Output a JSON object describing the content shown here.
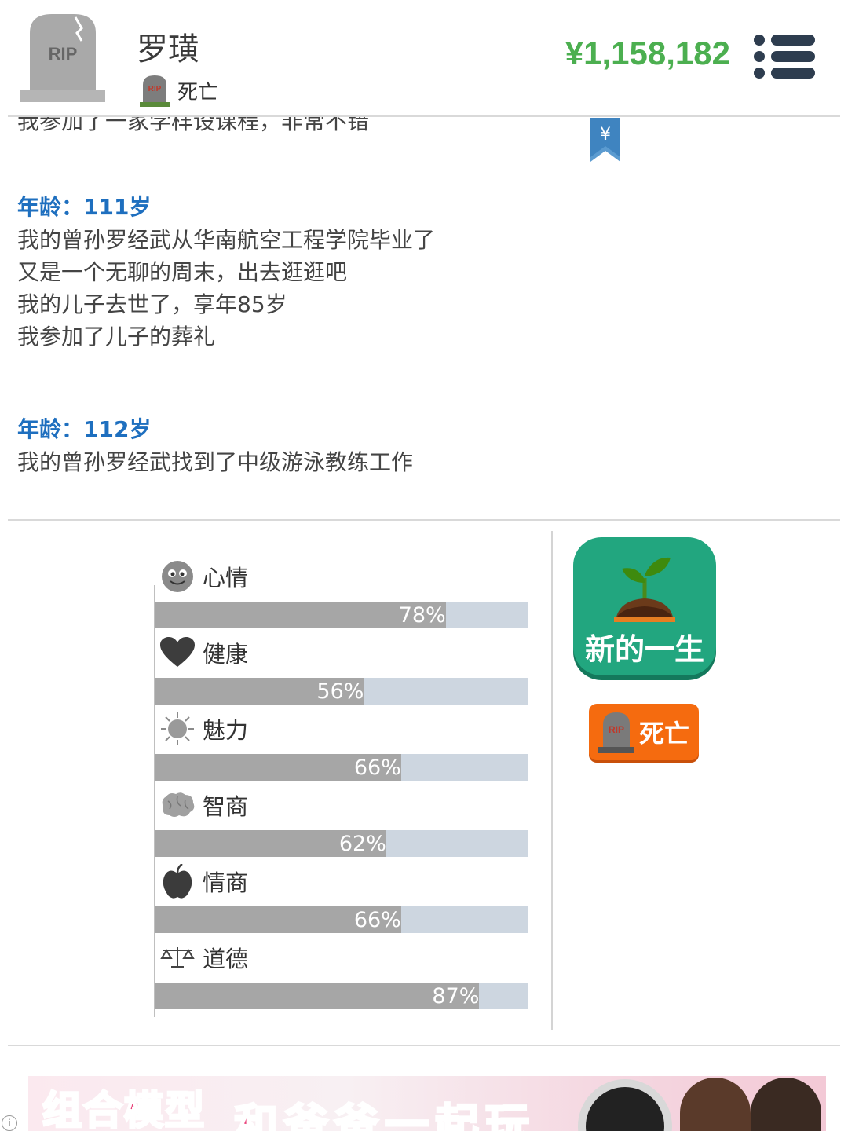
{
  "header": {
    "avatar_text": "RIP",
    "name": "罗璜",
    "status": "死亡",
    "money": "¥1,158,182"
  },
  "log": {
    "clipped_line": "我参加了一家学样设课程，非常不错",
    "bookmark_symbol": "¥",
    "entries": [
      {
        "age": "年龄：111岁",
        "lines": [
          "我的曾孙罗经武从华南航空工程学院毕业了",
          "又是一个无聊的周末，出去逛逛吧",
          "我的儿子去世了，享年85岁",
          "我参加了儿子的葬礼"
        ]
      },
      {
        "age": "年龄：112岁",
        "lines": [
          "我的曾孙罗经武找到了中级游泳教练工作"
        ]
      }
    ]
  },
  "stats": [
    {
      "label": "心情",
      "value": 78,
      "pct": "78%",
      "icon": "smiley-face-icon"
    },
    {
      "label": "健康",
      "value": 56,
      "pct": "56%",
      "icon": "heart-icon"
    },
    {
      "label": "魅力",
      "value": 66,
      "pct": "66%",
      "icon": "sun-icon"
    },
    {
      "label": "智商",
      "value": 62,
      "pct": "62%",
      "icon": "brain-icon"
    },
    {
      "label": "情商",
      "value": 66,
      "pct": "66%",
      "icon": "apple-icon"
    },
    {
      "label": "道德",
      "value": 87,
      "pct": "87%",
      "icon": "scales-icon"
    }
  ],
  "buttons": {
    "new_life": "新的一生",
    "dead": "死亡",
    "rip": "RIP"
  },
  "ad": {
    "text1": "组合模型",
    "text2": "和爸爸一起玩",
    "info": "i"
  },
  "colors": {
    "money": "#4caf50",
    "age_title": "#1e6fbf",
    "bar_fill": "#a6a6a6",
    "bar_track": "#cdd6e0",
    "new_life_button": "#22a67f",
    "dead_button": "#f56b0f"
  }
}
